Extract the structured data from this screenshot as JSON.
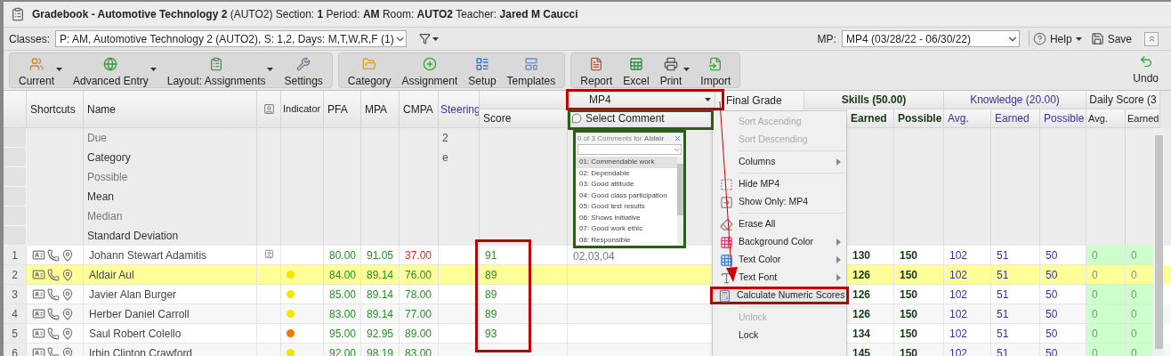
{
  "title": "**Gradebook - Automotive Technology 2** (AUTO2) Section: **1** Period: **AM** Room: **AUTO2** Teacher: **Jared M Caucci**",
  "classes": {
    "label": "Classes:",
    "value": "P: AM, Automotive Technology 2 (AUTO2), S: 1,2, Days: M,T,W,R,F (1)"
  },
  "mp": {
    "label": "MP:",
    "value": "MP4 (03/28/22 - 06/30/22)"
  },
  "help": "Help",
  "save": "Save",
  "toolbar_groups": [
    [
      {
        "label": "Current",
        "menu": true
      },
      {
        "label": "Advanced Entry",
        "menu": true
      },
      {
        "label": "Layout: Assignments",
        "menu": true
      },
      {
        "label": "Settings",
        "menu": false
      }
    ],
    [
      {
        "label": "Category",
        "menu": false
      },
      {
        "label": "Assignment",
        "menu": false
      },
      {
        "label": "Setup",
        "menu": false
      },
      {
        "label": "Templates",
        "menu": false
      }
    ],
    [
      {
        "label": "Report",
        "menu": false
      },
      {
        "label": "Excel",
        "menu": false
      },
      {
        "label": "Print",
        "menu": true
      },
      {
        "label": "Import",
        "menu": false
      }
    ]
  ],
  "undo": "Undo",
  "grid": {
    "columns": {
      "shortcuts": "Shortcuts",
      "name": "Name",
      "indicator": "Indicator",
      "pfa": "PFA",
      "mpa": "MPA",
      "cmpa": "CMPA",
      "steering": "Steering",
      "score": "Score",
      "mp4": "MP4",
      "select_comment": "Select Comment",
      "final_grade": "Final Grade"
    },
    "groups": [
      {
        "label": "Skills (50.00)",
        "columns": [
          "Earned",
          "Possible"
        ]
      },
      {
        "label": "Knowledge (20.00)",
        "columns": [
          "Avg.",
          "Earned",
          "Possible"
        ]
      },
      {
        "label": "Daily Score (3",
        "columns": [
          "Avg.",
          "Earned"
        ]
      }
    ],
    "summary_rows": [
      {
        "label": "Due",
        "steering": "2"
      },
      {
        "label": "Category",
        "steering": "e"
      },
      {
        "label": "Possible"
      },
      {
        "label": "Mean"
      },
      {
        "label": "Median"
      },
      {
        "label": "Standard Deviation"
      }
    ],
    "rows": [
      {
        "number": "1",
        "name": "Johann Stewart Adamitis",
        "photo": true,
        "pfa": "80.00",
        "mpa": "91.05",
        "cmpa": "37.00",
        "cmpa_failing": true,
        "score": "91",
        "comment": "02,03,04",
        "skills_earned": "130",
        "skills_possible": "150",
        "knowledge_avg": "102",
        "knowledge_earned": "51",
        "knowledge_possible": "50",
        "daily_avg": "0",
        "daily_earned": "0",
        "selected": false
      },
      {
        "number": "2",
        "name": "Aldair Aul",
        "photo": false,
        "indicator": {
          "color": "#f2e600"
        },
        "pfa": "84.00",
        "mpa": "89.14",
        "cmpa": "76.00",
        "cmpa_failing": false,
        "score": "89",
        "skills_earned": "126",
        "skills_possible": "150",
        "knowledge_avg": "102",
        "knowledge_earned": "51",
        "knowledge_possible": "50",
        "daily_avg": "0",
        "daily_earned": "0",
        "selected": true
      },
      {
        "number": "3",
        "name": "Javier Alan Burger",
        "photo": false,
        "indicator": {
          "color": "#f2e600"
        },
        "pfa": "85.00",
        "mpa": "89.14",
        "cmpa": "78.00",
        "cmpa_failing": false,
        "score": "89",
        "skills_earned": "126",
        "skills_possible": "150",
        "knowledge_avg": "102",
        "knowledge_earned": "51",
        "knowledge_possible": "50",
        "daily_avg": "0",
        "daily_earned": "0",
        "selected": false
      },
      {
        "number": "4",
        "name": "Herber Daniel Carroll",
        "photo": false,
        "indicator": {
          "color": "#f2e600"
        },
        "pfa": "83.00",
        "mpa": "89.14",
        "cmpa": "77.00",
        "cmpa_failing": false,
        "score": "89",
        "skills_earned": "126",
        "skills_possible": "150",
        "knowledge_avg": "102",
        "knowledge_earned": "51",
        "knowledge_possible": "50",
        "daily_avg": "0",
        "daily_earned": "0",
        "selected": false
      },
      {
        "number": "5",
        "name": "Saul Robert Colello",
        "photo": false,
        "indicator": {
          "color": "#f07800"
        },
        "pfa": "95.00",
        "mpa": "92.95",
        "cmpa": "89.00",
        "cmpa_failing": false,
        "score": "93",
        "skills_earned": "134",
        "skills_possible": "150",
        "knowledge_avg": "102",
        "knowledge_earned": "51",
        "knowledge_possible": "50",
        "daily_avg": "0",
        "daily_earned": "0",
        "selected": false
      },
      {
        "number": "6",
        "name": "Irbin Clinton Crawford",
        "photo": false,
        "indicator": {
          "color": "#f2e600"
        },
        "pfa": "92.00",
        "mpa": "98.19",
        "cmpa": "83.00",
        "cmpa_failing": false,
        "skills_earned": "145",
        "skills_possible": "150",
        "knowledge_avg": "102",
        "knowledge_earned": "51",
        "knowledge_possible": "50",
        "daily_avg": "0",
        "daily_earned": "0",
        "selected": false
      }
    ]
  },
  "comment_popup": {
    "header": "0 of 3 Comments for **Aldair**",
    "items": [
      {
        "label": "01: Commendable work",
        "selected": true
      },
      {
        "label": "02: Dependable",
        "selected": false
      },
      {
        "label": "03: Good attitude",
        "selected": false
      },
      {
        "label": "04: Good class participation",
        "selected": false
      },
      {
        "label": "05: Good test results",
        "selected": false
      },
      {
        "label": "06: Shows initiative",
        "selected": false
      },
      {
        "label": "07: Good work ethic",
        "selected": false
      },
      {
        "label": "08: Responsible",
        "selected": false
      }
    ]
  },
  "context_menu": [
    {
      "label": "Sort Ascending",
      "disabled": true,
      "submenu": false,
      "selected": false,
      "separator_before": false
    },
    {
      "label": "Sort Descending",
      "disabled": true,
      "submenu": false,
      "selected": false,
      "separator_before": false
    },
    {
      "label": "Columns",
      "disabled": false,
      "submenu": true,
      "selected": false,
      "separator_before": true
    },
    {
      "label": "Hide MP4",
      "disabled": false,
      "submenu": false,
      "selected": false,
      "separator_before": true
    },
    {
      "label": "Show Only: MP4",
      "disabled": false,
      "submenu": false,
      "selected": false,
      "separator_before": false
    },
    {
      "label": "Erase All",
      "disabled": false,
      "submenu": false,
      "selected": false,
      "separator_before": true
    },
    {
      "label": "Background Color",
      "disabled": false,
      "submenu": true,
      "selected": false,
      "separator_before": false
    },
    {
      "label": "Text Color",
      "disabled": false,
      "submenu": true,
      "selected": false,
      "separator_before": false
    },
    {
      "label": "Text Font",
      "disabled": false,
      "submenu": true,
      "selected": false,
      "separator_before": false
    },
    {
      "label": "Calculate Numeric Scores",
      "disabled": false,
      "submenu": false,
      "selected": true,
      "separator_before": false
    },
    {
      "label": "Unlock",
      "disabled": true,
      "submenu": false,
      "selected": false,
      "separator_before": true
    },
    {
      "label": "Lock",
      "disabled": false,
      "submenu": false,
      "selected": false,
      "separator_before": false
    }
  ]
}
